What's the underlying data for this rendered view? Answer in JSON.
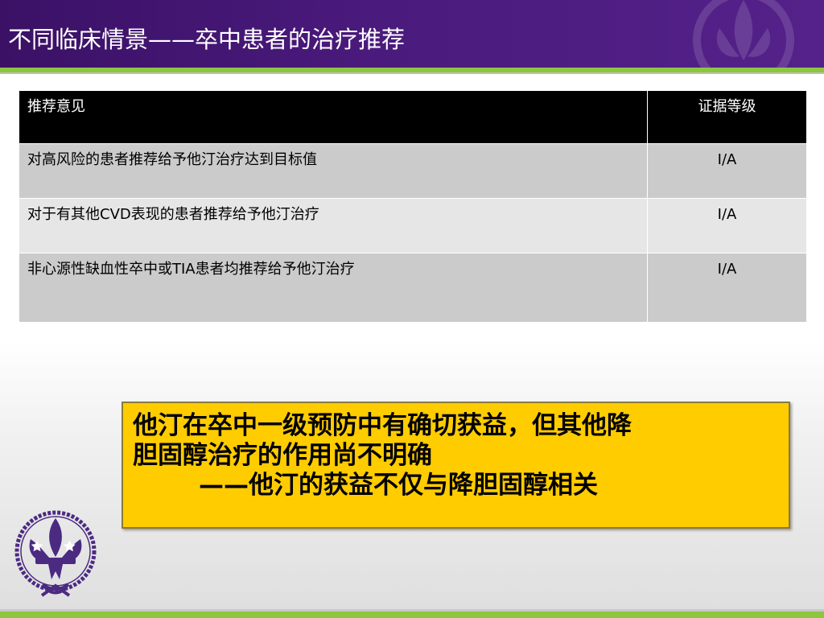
{
  "header": {
    "title": "不同临床情景——卒中患者的治疗推荐"
  },
  "table": {
    "columns": [
      "推荐意见",
      "证据等级"
    ],
    "rows": [
      {
        "recommendation": "对高风险的患者推荐给予他汀治疗达到目标值",
        "grade": "Ⅰ/A"
      },
      {
        "recommendation": "对于有其他CVD表现的患者推荐给予他汀治疗",
        "grade": "Ⅰ/A"
      },
      {
        "recommendation": "非心源性缺血性卒中或TIA患者均推荐给予他汀治疗",
        "grade": "Ⅰ/A"
      }
    ]
  },
  "callout": {
    "line1": "他汀在卒中一级预防中有确切获益，但其他降",
    "line2": "胆固醇治疗的作用尚不明确",
    "line3": "——他汀的获益不仅与降胆固醇相关"
  },
  "colors": {
    "header_purple": "#4a1a7c",
    "accent_green": "#8cc63f",
    "callout_yellow": "#ffcc00",
    "logo_purple": "#4b2a82"
  },
  "icons": {
    "logo": "fleur-de-lis-emblem-icon",
    "header_watermark": "fleur-de-lis-watermark-icon"
  }
}
